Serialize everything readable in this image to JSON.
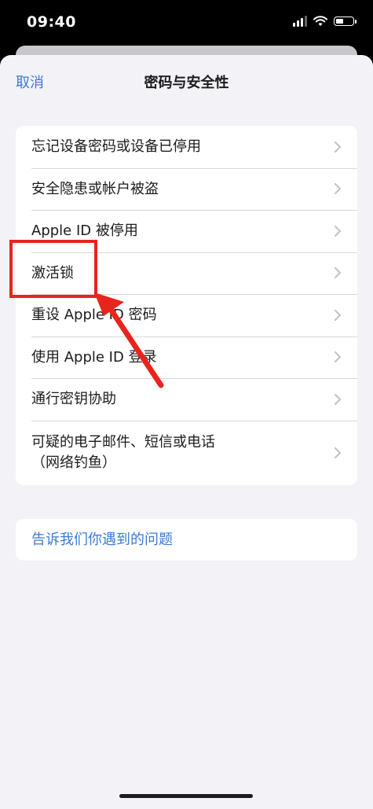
{
  "status_bar": {
    "time": "09:40"
  },
  "nav": {
    "cancel_label": "取消",
    "title": "密码与安全性"
  },
  "menu": {
    "items": [
      {
        "label": "忘记设备密码或设备已停用"
      },
      {
        "label": "安全隐患或帐户被盗"
      },
      {
        "label": "Apple ID 被停用"
      },
      {
        "label": "激活锁"
      },
      {
        "label": "重设 Apple ID 密码"
      },
      {
        "label": "使用 Apple ID 登录"
      },
      {
        "label": "通行密钥协助"
      },
      {
        "label": "可疑的电子邮件、短信或电话\n（网络钓鱼）"
      }
    ]
  },
  "report": {
    "label": "告诉我们你遇到的问题"
  },
  "colors": {
    "accent": "#3a7bd5",
    "annotation": "#e8251c",
    "background": "#f2f2f7"
  },
  "icons": {
    "row_chevron": "chevron-right-icon"
  }
}
